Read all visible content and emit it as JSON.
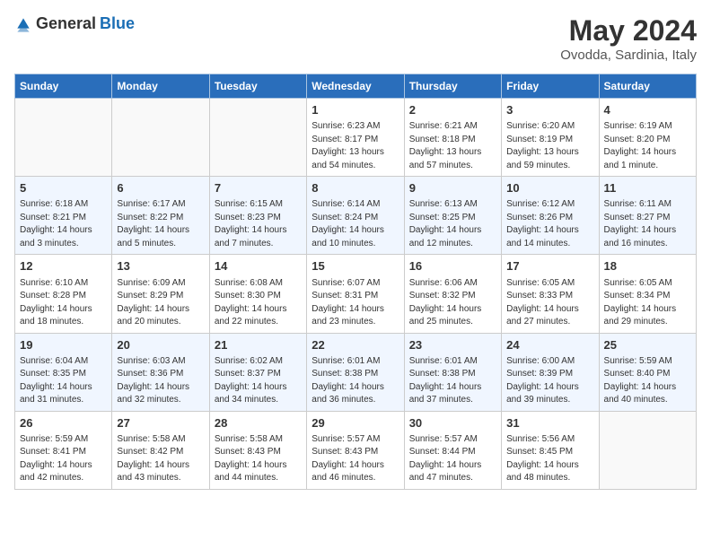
{
  "header": {
    "logo": {
      "general": "General",
      "blue": "Blue"
    },
    "title": "May 2024",
    "location": "Ovodda, Sardinia, Italy"
  },
  "weekdays": [
    "Sunday",
    "Monday",
    "Tuesday",
    "Wednesday",
    "Thursday",
    "Friday",
    "Saturday"
  ],
  "weeks": [
    [
      {
        "day": "",
        "info": ""
      },
      {
        "day": "",
        "info": ""
      },
      {
        "day": "",
        "info": ""
      },
      {
        "day": "1",
        "info": "Sunrise: 6:23 AM\nSunset: 8:17 PM\nDaylight: 13 hours\nand 54 minutes."
      },
      {
        "day": "2",
        "info": "Sunrise: 6:21 AM\nSunset: 8:18 PM\nDaylight: 13 hours\nand 57 minutes."
      },
      {
        "day": "3",
        "info": "Sunrise: 6:20 AM\nSunset: 8:19 PM\nDaylight: 13 hours\nand 59 minutes."
      },
      {
        "day": "4",
        "info": "Sunrise: 6:19 AM\nSunset: 8:20 PM\nDaylight: 14 hours\nand 1 minute."
      }
    ],
    [
      {
        "day": "5",
        "info": "Sunrise: 6:18 AM\nSunset: 8:21 PM\nDaylight: 14 hours\nand 3 minutes."
      },
      {
        "day": "6",
        "info": "Sunrise: 6:17 AM\nSunset: 8:22 PM\nDaylight: 14 hours\nand 5 minutes."
      },
      {
        "day": "7",
        "info": "Sunrise: 6:15 AM\nSunset: 8:23 PM\nDaylight: 14 hours\nand 7 minutes."
      },
      {
        "day": "8",
        "info": "Sunrise: 6:14 AM\nSunset: 8:24 PM\nDaylight: 14 hours\nand 10 minutes."
      },
      {
        "day": "9",
        "info": "Sunrise: 6:13 AM\nSunset: 8:25 PM\nDaylight: 14 hours\nand 12 minutes."
      },
      {
        "day": "10",
        "info": "Sunrise: 6:12 AM\nSunset: 8:26 PM\nDaylight: 14 hours\nand 14 minutes."
      },
      {
        "day": "11",
        "info": "Sunrise: 6:11 AM\nSunset: 8:27 PM\nDaylight: 14 hours\nand 16 minutes."
      }
    ],
    [
      {
        "day": "12",
        "info": "Sunrise: 6:10 AM\nSunset: 8:28 PM\nDaylight: 14 hours\nand 18 minutes."
      },
      {
        "day": "13",
        "info": "Sunrise: 6:09 AM\nSunset: 8:29 PM\nDaylight: 14 hours\nand 20 minutes."
      },
      {
        "day": "14",
        "info": "Sunrise: 6:08 AM\nSunset: 8:30 PM\nDaylight: 14 hours\nand 22 minutes."
      },
      {
        "day": "15",
        "info": "Sunrise: 6:07 AM\nSunset: 8:31 PM\nDaylight: 14 hours\nand 23 minutes."
      },
      {
        "day": "16",
        "info": "Sunrise: 6:06 AM\nSunset: 8:32 PM\nDaylight: 14 hours\nand 25 minutes."
      },
      {
        "day": "17",
        "info": "Sunrise: 6:05 AM\nSunset: 8:33 PM\nDaylight: 14 hours\nand 27 minutes."
      },
      {
        "day": "18",
        "info": "Sunrise: 6:05 AM\nSunset: 8:34 PM\nDaylight: 14 hours\nand 29 minutes."
      }
    ],
    [
      {
        "day": "19",
        "info": "Sunrise: 6:04 AM\nSunset: 8:35 PM\nDaylight: 14 hours\nand 31 minutes."
      },
      {
        "day": "20",
        "info": "Sunrise: 6:03 AM\nSunset: 8:36 PM\nDaylight: 14 hours\nand 32 minutes."
      },
      {
        "day": "21",
        "info": "Sunrise: 6:02 AM\nSunset: 8:37 PM\nDaylight: 14 hours\nand 34 minutes."
      },
      {
        "day": "22",
        "info": "Sunrise: 6:01 AM\nSunset: 8:38 PM\nDaylight: 14 hours\nand 36 minutes."
      },
      {
        "day": "23",
        "info": "Sunrise: 6:01 AM\nSunset: 8:38 PM\nDaylight: 14 hours\nand 37 minutes."
      },
      {
        "day": "24",
        "info": "Sunrise: 6:00 AM\nSunset: 8:39 PM\nDaylight: 14 hours\nand 39 minutes."
      },
      {
        "day": "25",
        "info": "Sunrise: 5:59 AM\nSunset: 8:40 PM\nDaylight: 14 hours\nand 40 minutes."
      }
    ],
    [
      {
        "day": "26",
        "info": "Sunrise: 5:59 AM\nSunset: 8:41 PM\nDaylight: 14 hours\nand 42 minutes."
      },
      {
        "day": "27",
        "info": "Sunrise: 5:58 AM\nSunset: 8:42 PM\nDaylight: 14 hours\nand 43 minutes."
      },
      {
        "day": "28",
        "info": "Sunrise: 5:58 AM\nSunset: 8:43 PM\nDaylight: 14 hours\nand 44 minutes."
      },
      {
        "day": "29",
        "info": "Sunrise: 5:57 AM\nSunset: 8:43 PM\nDaylight: 14 hours\nand 46 minutes."
      },
      {
        "day": "30",
        "info": "Sunrise: 5:57 AM\nSunset: 8:44 PM\nDaylight: 14 hours\nand 47 minutes."
      },
      {
        "day": "31",
        "info": "Sunrise: 5:56 AM\nSunset: 8:45 PM\nDaylight: 14 hours\nand 48 minutes."
      },
      {
        "day": "",
        "info": ""
      }
    ]
  ]
}
